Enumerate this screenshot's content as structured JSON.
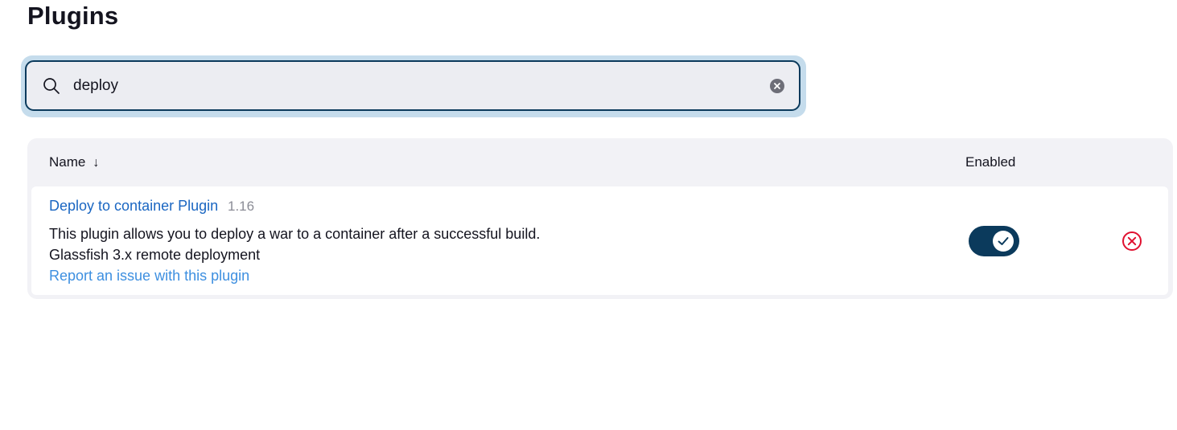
{
  "page": {
    "title": "Plugins"
  },
  "search": {
    "value": "deploy",
    "placeholder": "Search plugin settings"
  },
  "table": {
    "columns": {
      "name": "Name",
      "sort_indicator": "↓",
      "enabled": "Enabled"
    },
    "rows": [
      {
        "name": "Deploy to container Plugin",
        "version": "1.16",
        "description_lines": [
          "This plugin allows you to deploy a war to a container after a successful build.",
          "Glassfish 3.x remote deployment"
        ],
        "report_link": "Report an issue with this plugin",
        "enabled": true
      }
    ]
  },
  "icons": {
    "search": "search-icon",
    "clear": "clear-icon",
    "check": "check-icon",
    "uninstall": "close-circle-icon"
  },
  "colors": {
    "accent": "#0b3a5c",
    "link": "#1a66c2",
    "link_light": "#3d8fe0",
    "danger": "#e0102f",
    "focus_ring": "#c5dcec"
  }
}
